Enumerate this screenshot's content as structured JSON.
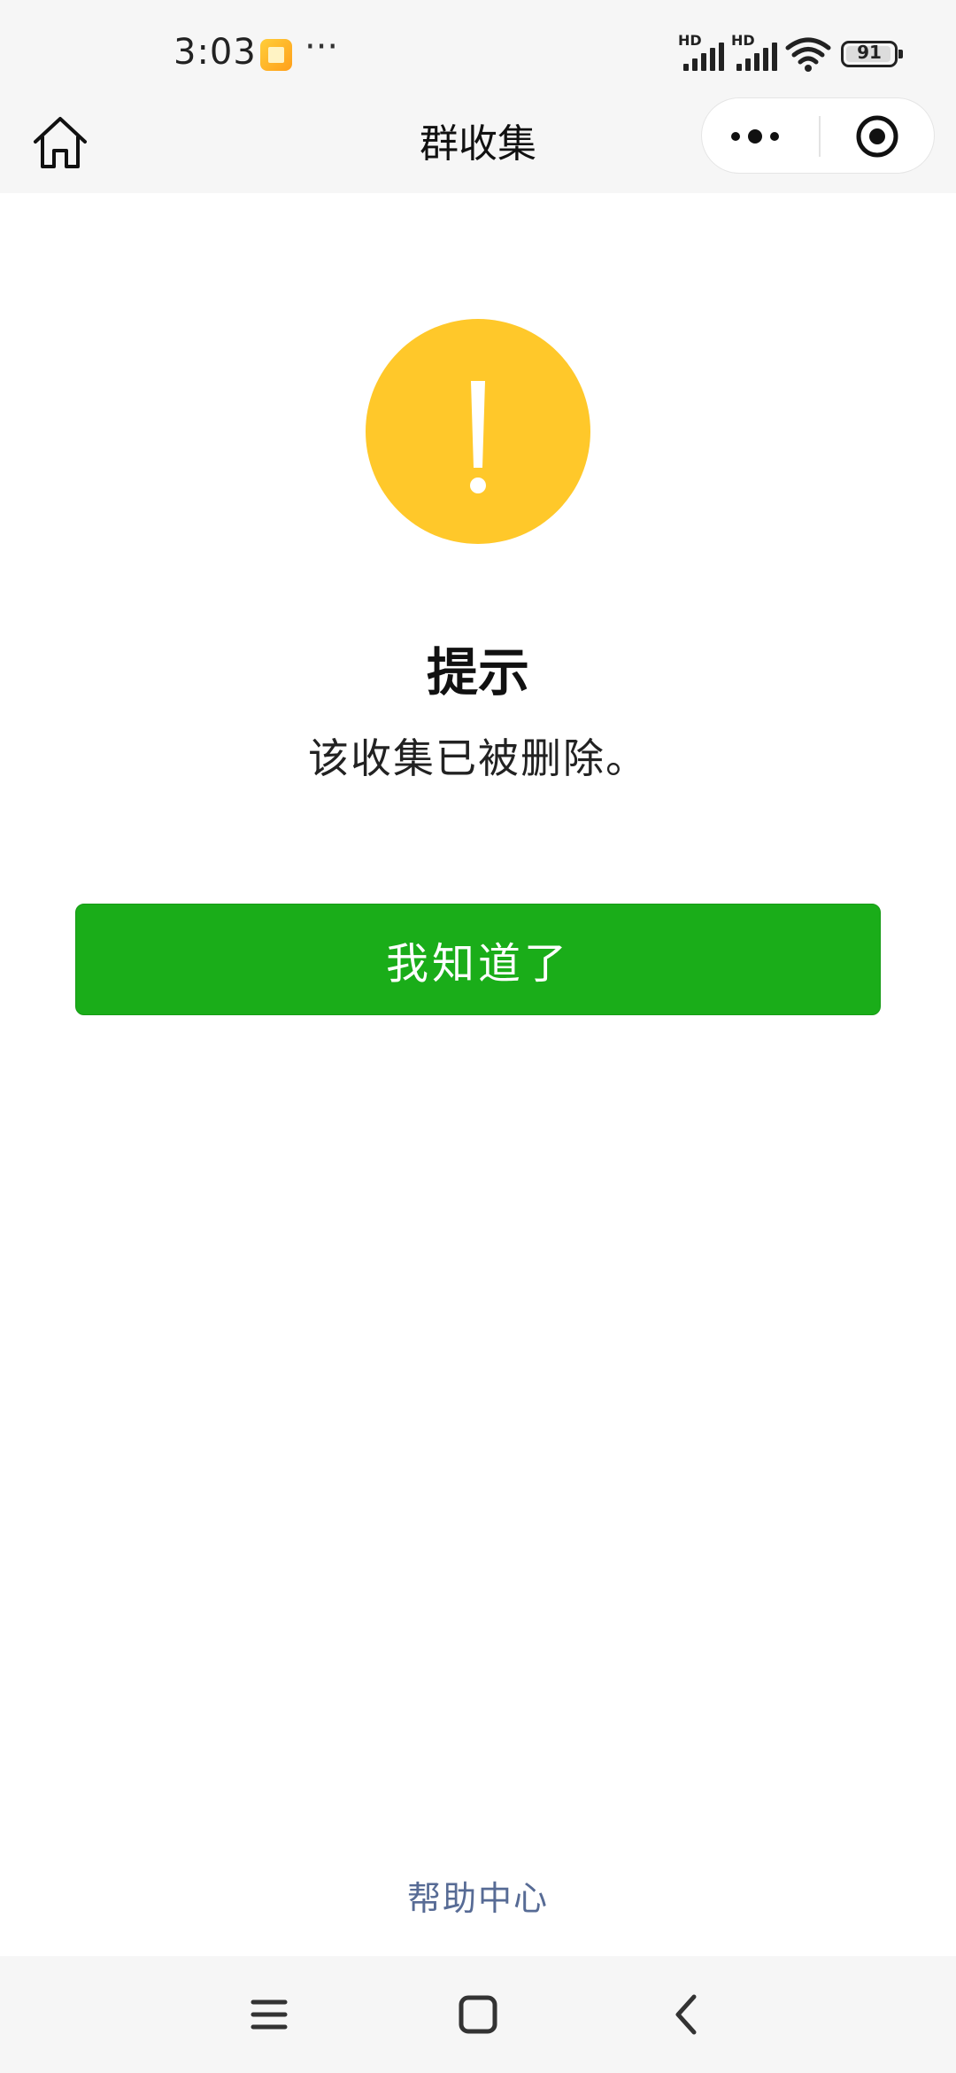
{
  "status_bar": {
    "time": "3:03",
    "more": "···",
    "signal1_label": "HD",
    "signal2_label": "HD",
    "battery_level": "91",
    "app_icon": "gallery-icon"
  },
  "title_bar": {
    "title": "群收集",
    "home_icon": "home-icon",
    "more_icon": "more-dots-icon",
    "close_icon": "target-close-icon"
  },
  "content": {
    "icon": "exclamation-icon",
    "icon_color": "#ffc82a",
    "title": "提示",
    "message": "该收集已被删除。",
    "confirm_label": "我知道了",
    "confirm_color": "#1aad19",
    "help_label": "帮助中心",
    "help_color": "#576b95"
  },
  "nav_bar": {
    "menu_icon": "menu-icon",
    "home_icon": "square-home-icon",
    "back_icon": "back-chevron-icon"
  }
}
